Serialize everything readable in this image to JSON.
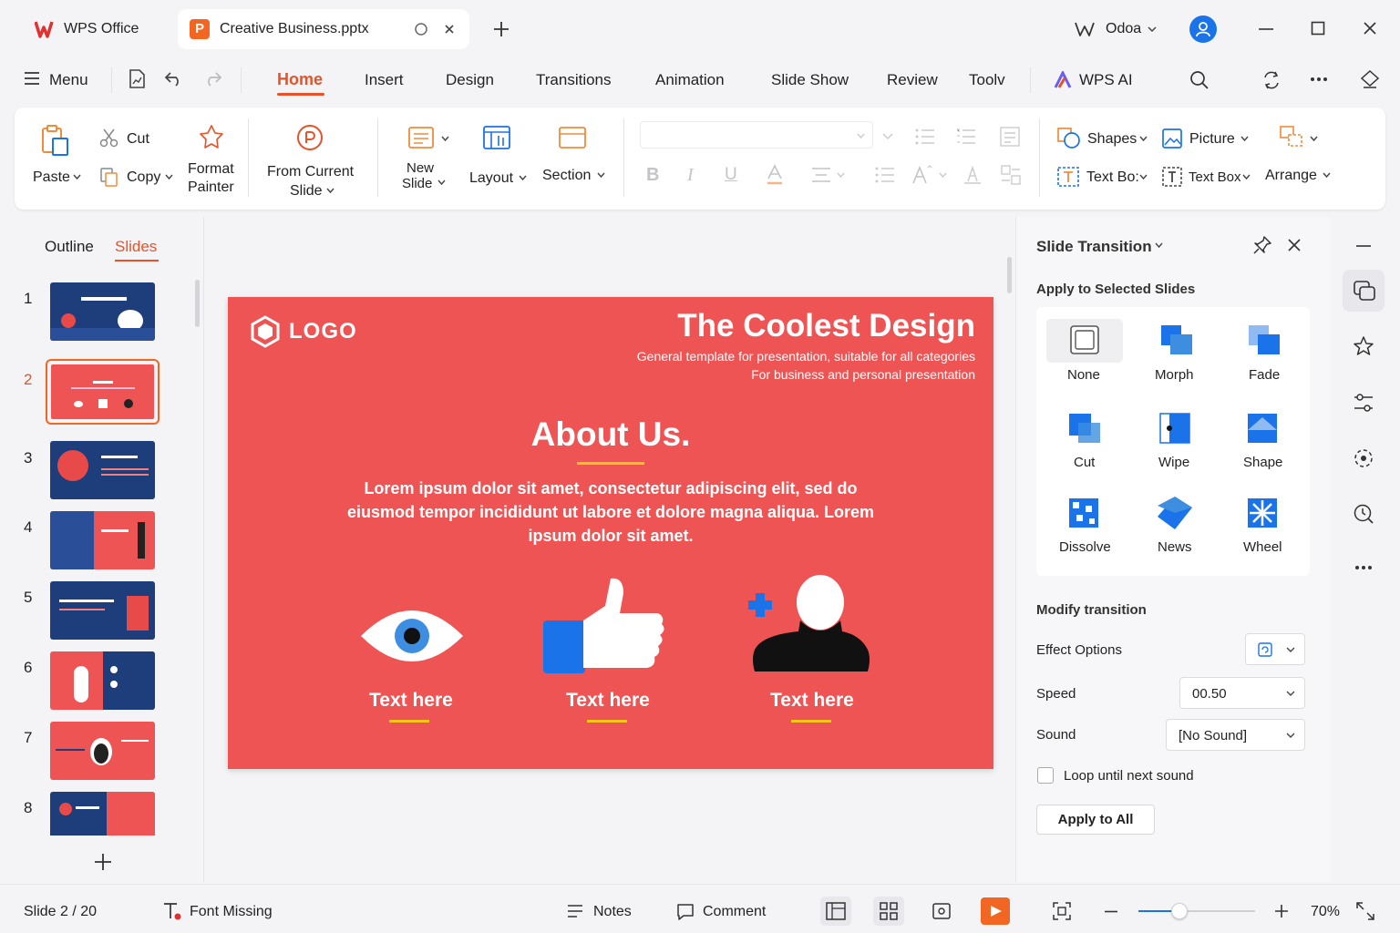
{
  "titlebar": {
    "app_name": "WPS Office",
    "doc_tab": "Creative Business.pptx",
    "account": "Odoa"
  },
  "menubar": {
    "menu_label": "Menu",
    "tabs": [
      "Home",
      "Insert",
      "Design",
      "Transitions",
      "Animation",
      "Slide Show",
      "Review",
      "Toolv"
    ],
    "active_tab": "Home",
    "wps_ai": "WPS AI"
  },
  "ribbon": {
    "paste": "Paste",
    "cut": "Cut",
    "copy": "Copy",
    "format_painter_1": "Format",
    "format_painter_2": "Painter",
    "from_current_1": "From Current",
    "from_current_2": "Slide",
    "new_slide_1": "New",
    "new_slide_2": "Slide",
    "layout": "Layout",
    "section": "Section",
    "shapes": "Shapes",
    "picture": "Picture",
    "textbox_1": "Text Bo:",
    "textbox_2": "Text Box",
    "arrange": "Arrange"
  },
  "left_panel": {
    "outline_tab": "Outline",
    "slides_tab": "Slides",
    "slide_numbers": [
      "1",
      "2",
      "3",
      "4",
      "5",
      "6",
      "7",
      "8"
    ],
    "selected": "2"
  },
  "slide": {
    "logo": "LOGO",
    "title": "The Coolest Design",
    "subtitle_1": "General template for presentation, suitable for all categories",
    "subtitle_2": "For business and personal presentation",
    "heading": "About Us.",
    "body": "Lorem ipsum dolor sit amet, consectetur adipiscing elit, sed do eiusmod tempor incididunt ut labore et dolore magna aliqua. Lorem ipsum dolor sit amet.",
    "captions": [
      "Text here",
      "Text here",
      "Text here"
    ],
    "bg_color": "#ef5454",
    "accent_color": "#f5c518"
  },
  "transition_panel": {
    "title": "Slide Transition",
    "apply_selected": "Apply to Selected Slides",
    "effects": [
      "None",
      "Morph",
      "Fade",
      "Cut",
      "Wipe",
      "Shape",
      "Dissolve",
      "News",
      "Wheel"
    ],
    "modify_title": "Modify transition",
    "effect_options": "Effect Options",
    "speed_label": "Speed",
    "speed_value": "00.50",
    "sound_label": "Sound",
    "sound_value": "[No Sound]",
    "loop_label": "Loop until next sound",
    "apply_all": "Apply to All"
  },
  "statusbar": {
    "slide_indicator": "Slide 2 / 20",
    "font_missing": "Font Missing",
    "notes": "Notes",
    "comment": "Comment",
    "zoom": "70%",
    "zoom_level": 0.35
  },
  "colors": {
    "accent": "#e5532a",
    "blue": "#1a73e8"
  }
}
